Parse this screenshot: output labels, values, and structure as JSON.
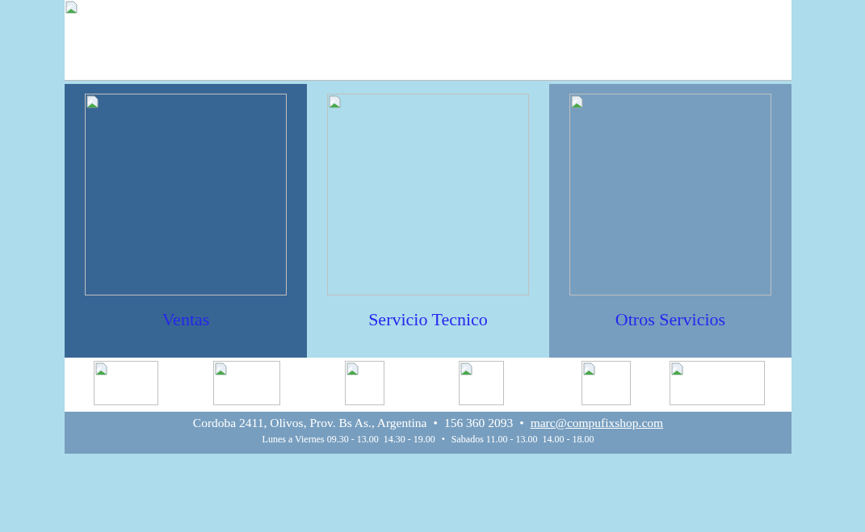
{
  "banner": {
    "kind": "image"
  },
  "sections": [
    {
      "label": "Ventas",
      "color": "#386694"
    },
    {
      "label": "Servicio Tecnico",
      "color": "#addcec"
    },
    {
      "label": "Otros Servicios",
      "color": "#779ebf"
    }
  ],
  "logos": [
    {
      "kind": "image"
    },
    {
      "kind": "image"
    },
    {
      "kind": "image"
    },
    {
      "kind": "image"
    },
    {
      "kind": "image"
    },
    {
      "kind": "image"
    }
  ],
  "footer": {
    "lines": [
      {
        "items": [
          {
            "kind": "text",
            "text": "Cordoba 2411, Olivos, Prov. Bs As., Argentina"
          },
          {
            "kind": "separator",
            "text": "•"
          },
          {
            "kind": "text",
            "text": "156 360 2093"
          },
          {
            "kind": "separator",
            "text": "•"
          },
          {
            "kind": "link",
            "text": "marc@compufixshop.com"
          }
        ]
      },
      {
        "items": [
          {
            "kind": "text",
            "text": "Lunes a Viernes 09.30 - 13.00  14.30 - 19.00"
          },
          {
            "kind": "separator",
            "text": "•"
          },
          {
            "kind": "text",
            "text": "Sabados 11.00 - 13.00  14.00 - 18.00"
          }
        ]
      }
    ]
  }
}
